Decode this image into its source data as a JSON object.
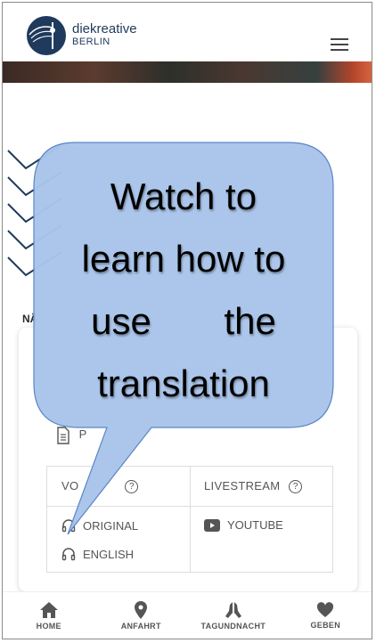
{
  "brand": {
    "line1": "diekreative",
    "line2": "BERLIN"
  },
  "section_label": "NÄ",
  "document_label": "P",
  "grid": {
    "col1_header": "VO",
    "col2_header": "LIVESTREAM",
    "help_glyph": "?",
    "options_audio": [
      "ORIGINAL",
      "ENGLISH"
    ],
    "options_stream": [
      "YOUTUBE"
    ]
  },
  "bottom_nav": [
    {
      "label": "HOME",
      "icon": "home-icon"
    },
    {
      "label": "ANFAHRT",
      "icon": "map-pin-icon"
    },
    {
      "label": "TAGUNDNACHT",
      "icon": "praying-hands-icon"
    },
    {
      "label": "GEBEN",
      "icon": "heart-icon"
    }
  ],
  "callout": {
    "text_lines": [
      "Watch to",
      "learn how to",
      "use       the",
      "translation"
    ]
  },
  "colors": {
    "brand_navy": "#1f3a5c",
    "callout_fill": "#a9c4ea",
    "callout_stroke": "#5a86c4"
  }
}
